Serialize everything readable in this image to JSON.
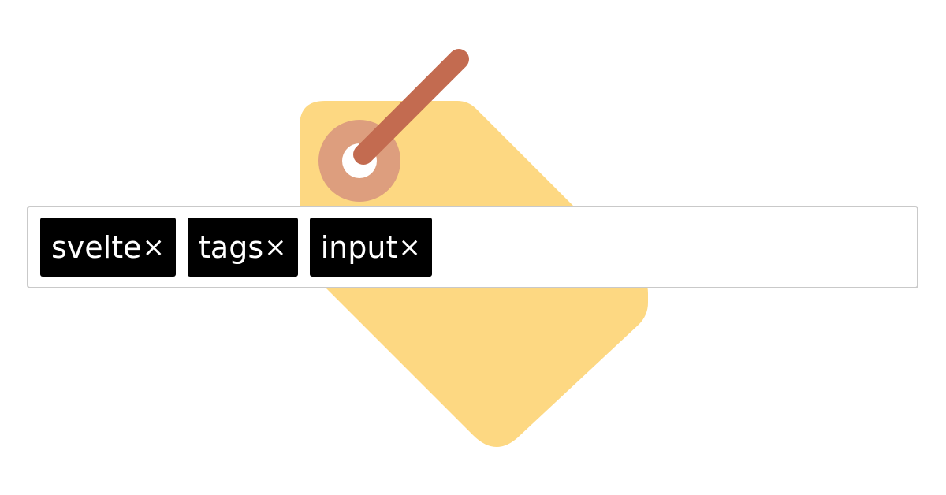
{
  "tags": [
    {
      "label": "svelte",
      "remove": "×"
    },
    {
      "label": "tags",
      "remove": "×"
    },
    {
      "label": "input",
      "remove": "×"
    }
  ],
  "input": {
    "value": "",
    "placeholder": ""
  },
  "illustration": {
    "icon": "price-tag-icon",
    "colors": {
      "tag_body": "#fdd882",
      "eyelet_ring": "#dd9e7e",
      "eyelet_hole": "#ffffff",
      "string": "#c36b50"
    }
  },
  "colors": {
    "chip_background": "#000000",
    "chip_text": "#ffffff",
    "input_border": "#c9c9c9"
  }
}
